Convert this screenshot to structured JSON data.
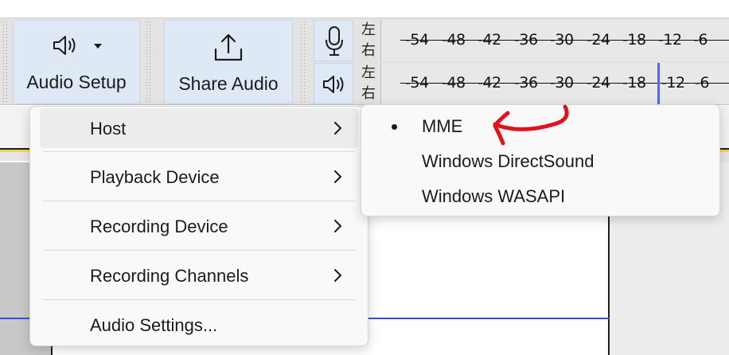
{
  "toolbar": {
    "audio_setup_label": "Audio Setup",
    "share_audio_label": "Share Audio",
    "audio_setup_icon": "speaker-icon",
    "share_audio_icon": "share-upload-icon"
  },
  "meters": {
    "recording": {
      "icon": "microphone-icon",
      "channel_left": "左",
      "channel_right": "右",
      "ticks": [
        "-54",
        "-48",
        "-42",
        "-36",
        "-30",
        "-24",
        "-18",
        "-12",
        "-6"
      ]
    },
    "playback": {
      "icon": "speaker-icon",
      "channel_left": "左",
      "channel_right": "右",
      "ticks": [
        "-54",
        "-48",
        "-42",
        "-36",
        "-30",
        "-24",
        "-18",
        "-12",
        "-6"
      ]
    },
    "marker_color": "#5a68d8"
  },
  "menu": {
    "items": [
      {
        "label": "Host",
        "has_submenu": true
      },
      {
        "label": "Playback Device",
        "has_submenu": true
      },
      {
        "label": "Recording Device",
        "has_submenu": true
      },
      {
        "label": "Recording Channels",
        "has_submenu": true
      },
      {
        "label": "Audio Settings...",
        "has_submenu": false
      }
    ]
  },
  "host_submenu": {
    "items": [
      {
        "label": "MME",
        "selected": true
      },
      {
        "label": "Windows DirectSound",
        "selected": false
      },
      {
        "label": "Windows WASAPI",
        "selected": false
      }
    ]
  },
  "colors": {
    "toolbar_button_bg": "#dfe9f6",
    "wave_line": "#3d4ecb",
    "annotation_arrow": "#e0121b",
    "selection_line": "#ffd24a"
  }
}
